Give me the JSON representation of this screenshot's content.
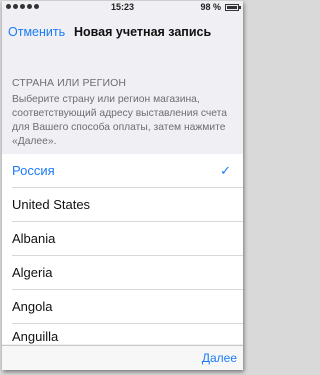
{
  "status_bar": {
    "time": "15:23",
    "battery_percent": "98 %",
    "battery_level": 0.98
  },
  "nav": {
    "cancel_label": "Отменить",
    "title": "Новая учетная запись"
  },
  "section": {
    "header": "СТРАНА ИЛИ РЕГИОН",
    "description": "Выберите страну или регион магазина, соответствующий адресу выставления счета для Вашего способа оплаты, затем нажмите «Далее»."
  },
  "countries": [
    {
      "label": "Россия",
      "selected": true
    },
    {
      "label": "United States",
      "selected": false
    },
    {
      "label": "Albania",
      "selected": false
    },
    {
      "label": "Algeria",
      "selected": false
    },
    {
      "label": "Angola",
      "selected": false
    },
    {
      "label": "Anguilla",
      "selected": false
    }
  ],
  "toolbar": {
    "next_label": "Далее"
  },
  "colors": {
    "accent": "#1b7cf5",
    "background": "#efeff4"
  }
}
